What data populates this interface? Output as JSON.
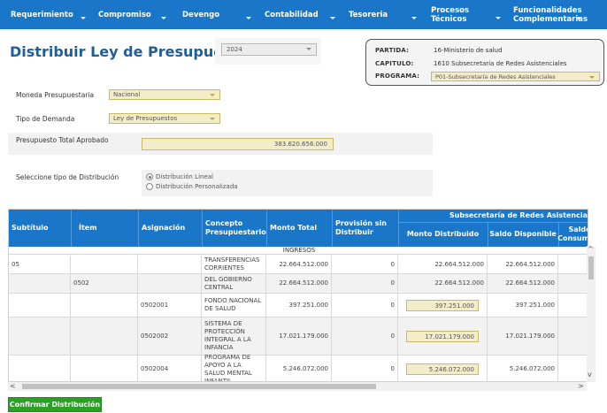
{
  "nav": {
    "items": [
      {
        "label": "Requerimiento"
      },
      {
        "label": "Compromiso"
      },
      {
        "label": "Devengo"
      },
      {
        "label": "Contabilidad"
      },
      {
        "label": "Tesoreria"
      },
      {
        "label_line1": "Procesos",
        "label_line2": "Técnicos"
      },
      {
        "label_line1": "Funcionalidades",
        "label_line2": "Complementarias"
      }
    ]
  },
  "page": {
    "title": "Distribuir Ley de Presupuestos",
    "year": "2024"
  },
  "info": {
    "partida_label": "PARTIDA:",
    "partida_value": "16-Ministerio de salud",
    "capitulo_label": "CAPITULO:",
    "capitulo_value": "1610 Subsecretaría de Redes Asistenciales",
    "programa_label": "PROGRAMA:",
    "programa_value": "P01-Subsecretaría de Redes Asistenciales"
  },
  "form": {
    "moneda_label": "Moneda Presupuestaria",
    "moneda_value": "Nacional",
    "demanda_label": "Tipo de Demanda",
    "demanda_value": "Ley de Presupuestos",
    "total_label": "Presupuesto Total Aprobado",
    "total_value": "383.620.656.000",
    "distribucion_label": "Seleccione tipo de Distribución",
    "radio_lineal": "Distribución Lineal",
    "radio_personalizada": "Distribución Personalizada",
    "selected_radio": "lineal"
  },
  "table": {
    "headers": {
      "subtitulo": "Subtítulo",
      "item": "Ítem",
      "asignacion": "Asignación",
      "concepto": "Concepto Presupuestario",
      "monto_total": "Monto Total",
      "provision": "Provisión sin Distribuir",
      "group": "Subsecretaría de Redes Asistencia",
      "monto_distribuido": "Monto Distribuido",
      "saldo_disponible": "Saldo Disponible",
      "saldo_consumido": "Saldo Consumido"
    },
    "section_label": "INGRESOS",
    "rows": [
      {
        "subtitulo": "05",
        "item": "",
        "asignacion": "",
        "concepto": "TRANSFERENCIAS CORRIENTES",
        "monto_total": "22.664.512.000",
        "provision": "0",
        "monto_distribuido": "22.664.512.000",
        "saldo_disponible": "22.664.512.000",
        "saldo_consumido": ""
      },
      {
        "subtitulo": "",
        "item": "0502",
        "asignacion": "",
        "concepto": "DEL GOBIERNO CENTRAL",
        "monto_total": "22.664.512.000",
        "provision": "0",
        "monto_distribuido": "22.664.512.000",
        "saldo_disponible": "22.664.512.000",
        "saldo_consumido": ""
      },
      {
        "subtitulo": "",
        "item": "",
        "asignacion": "0502001",
        "concepto": "FONDO NACIONAL DE SALUD",
        "monto_total": "397.251.000",
        "provision": "0",
        "monto_distribuido": "397.251.000",
        "saldo_disponible": "397.251.000",
        "saldo_consumido": ""
      },
      {
        "subtitulo": "",
        "item": "",
        "asignacion": "0502002",
        "concepto": "SISTEMA DE PROTECCIÓN INTEGRAL A LA INFANCIA",
        "monto_total": "17.021.179.000",
        "provision": "0",
        "monto_distribuido": "17.021.179.000",
        "saldo_disponible": "17.021.179.000",
        "saldo_consumido": ""
      },
      {
        "subtitulo": "",
        "item": "",
        "asignacion": "0502004",
        "concepto": "PROGRAMA DE APOYO A LA SALUD MENTAL INFANTIL",
        "monto_total": "5.246.072.000",
        "provision": "0",
        "monto_distribuido": "5.246.072.000",
        "saldo_disponible": "5.246.072.000",
        "saldo_consumido": ""
      }
    ]
  },
  "actions": {
    "confirm_label": "Confirmar Distribución"
  },
  "colors": {
    "nav_bg": "#1a76c8",
    "title": "#1f5e96",
    "field_bg": "#f3ecc9",
    "confirm_bg": "#2aa024"
  }
}
